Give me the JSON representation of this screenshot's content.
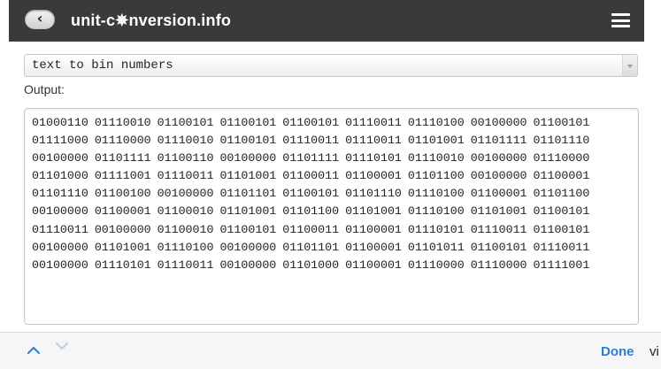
{
  "header": {
    "back_icon": "back-chevron-icon",
    "site_title": "unit-c✵nversion.info",
    "menu_icon": "hamburger-menu-icon"
  },
  "converter": {
    "selected_option": "text to bin numbers",
    "output_label": "Output:",
    "output_text": "01000110 01110010 01100101 01100101 01100101 01110011 01110100 00100000 01100101 01111000 01110000 01110010 01100101 01110011 01110011 01101001 01101111 01101110 00100000 01101111 01100110 00100000 01101111 01110101 01110010 00100000 01110000 01101000 01111001 01110011 01101001 01100011 01100001 01101100 00100000 01100001 01101110 01100100 00100000 01101101 01100101 01101110 01110100 01100001 01101100 00100000 01100001 01100010 01101001 01101100 01101001 01110100 01101001 01100101 01110011 00100000 01100010 01100101 01100011 01100001 01110101 01110011 01100101 00100000 01101001 01110100 00100000 01101101 01100001 01101011 01100101 01110011 00100000 01110101 01110011 00100000 01101000 01100001 01110000 01110000 01111001"
  },
  "keyboard_toolbar": {
    "up_icon": "chevron-up-icon",
    "down_icon": "chevron-down-icon",
    "done_label": "Done",
    "edge_text": "vi"
  },
  "colors": {
    "header_bg": "#3a3a3a",
    "done_blue": "#2a7fd4",
    "toolbar_bg": "#f4f6f8"
  }
}
